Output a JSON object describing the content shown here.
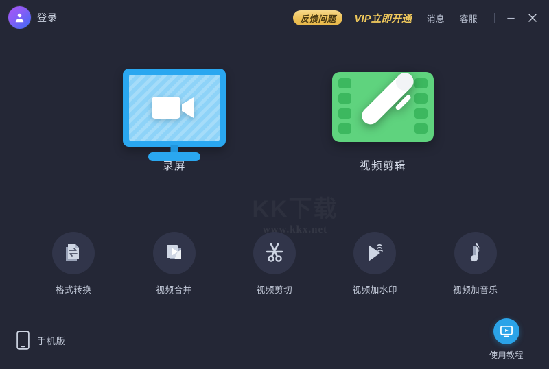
{
  "window": {
    "background_color": "#242736",
    "accent_blue": "#2aa7f0",
    "accent_green": "#5fd37e",
    "accent_gold": "#edc158"
  },
  "titlebar": {
    "login_label": "登录",
    "avatar_icon": "user-avatar-icon",
    "feedback_label": "反馈问题",
    "vip_label": "VIP立即开通",
    "message_label": "消息",
    "support_label": "客服",
    "minimize_icon": "minimize-icon",
    "close_icon": "close-icon"
  },
  "hero": {
    "cards": [
      {
        "id": "record",
        "label": "录屏",
        "icon": "monitor-video-camera-icon",
        "color": "#2aa7f0"
      },
      {
        "id": "edit",
        "label": "视频剪辑",
        "icon": "film-strip-pen-icon",
        "color": "#5fd37e"
      }
    ]
  },
  "watermark": {
    "big": "KK下载",
    "small": "www.kkx.net"
  },
  "tools": [
    {
      "id": "format-convert",
      "label": "格式转换",
      "icon": "document-exchange-icon"
    },
    {
      "id": "video-merge",
      "label": "视频合并",
      "icon": "stacked-play-documents-icon"
    },
    {
      "id": "video-cut",
      "label": "视频剪切",
      "icon": "scissors-icon"
    },
    {
      "id": "video-watermark",
      "label": "视频加水印",
      "icon": "play-waves-icon"
    },
    {
      "id": "video-music",
      "label": "视频加音乐",
      "icon": "music-note-icon"
    }
  ],
  "footer": {
    "mobile_label": "手机版",
    "mobile_icon": "smartphone-icon",
    "tutorial_label": "使用教程",
    "tutorial_icon": "monitor-play-icon"
  }
}
